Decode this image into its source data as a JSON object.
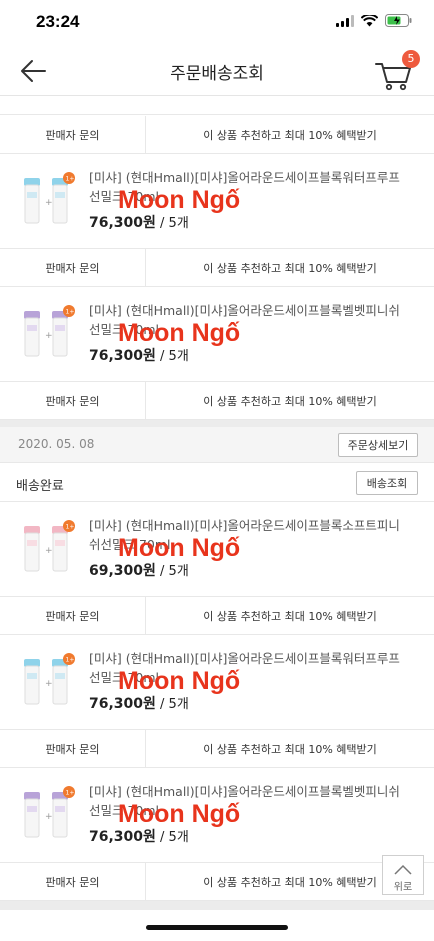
{
  "status_bar": {
    "time": "23:24"
  },
  "header": {
    "title": "주문배송조회",
    "cart_count": "5"
  },
  "actions": {
    "seller_inquiry": "판매자 문의",
    "recommend": "이 상품 추천하고 최대 10% 혜택받기"
  },
  "watermark_text": "Moon Ngố",
  "products_top": [
    {
      "name_line1": "[미샤] (현대Hmall)[미샤]올어라운드세이프블록워터프루프",
      "name_line2": "선밀크 70ml",
      "price": "76,300원",
      "qty": " / 5개",
      "variant": "blue"
    },
    {
      "name_line1": "[미샤] (현대Hmall)[미샤]올어라운드세이프블록벨벳피니쉬",
      "name_line2": "선밀크 70ml",
      "price": "76,300원",
      "qty": " / 5개",
      "variant": "purple"
    }
  ],
  "order": {
    "date": "2020. 05. 08",
    "detail_button": "주문상세보기",
    "status": "배송완료",
    "track_button": "배송조회",
    "products": [
      {
        "name_line1": "[미샤] (현대Hmall)[미샤]올어라운드세이프블록소프트피니",
        "name_line2": "쉬선밀크 70ml",
        "price": "69,300원",
        "qty": " / 5개",
        "variant": "pink"
      },
      {
        "name_line1": "[미샤] (현대Hmall)[미샤]올어라운드세이프블록워터프루프",
        "name_line2": "선밀크 70ml",
        "price": "76,300원",
        "qty": " / 5개",
        "variant": "blue"
      },
      {
        "name_line1": "[미샤] (현대Hmall)[미샤]올어라운드세이프블록벨벳피니쉬",
        "name_line2": "선밀크 70ml",
        "price": "76,300원",
        "qty": " / 5개",
        "variant": "purple"
      }
    ]
  },
  "scroll_top": {
    "label": "위로"
  },
  "colors": {
    "badge": "#ee5a3e",
    "watermark": "#e8341c",
    "cap_blue": "#8fd3ea",
    "cap_purple": "#b8a3d8",
    "cap_pink": "#f2b7c4"
  }
}
